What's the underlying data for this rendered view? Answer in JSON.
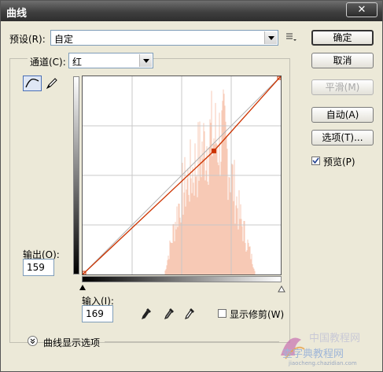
{
  "window": {
    "title": "曲线",
    "close_label": "✕"
  },
  "preset": {
    "label": "预设(R):",
    "value": "自定"
  },
  "channel": {
    "label": "通道(C):",
    "value": "红"
  },
  "buttons": {
    "ok": "确定",
    "cancel": "取消",
    "smooth": "平滑(M)",
    "auto": "自动(A)",
    "options": "选项(T)..."
  },
  "preview": {
    "label": "预览(P)",
    "checked": true
  },
  "output": {
    "label": "输出(O):",
    "value": "159"
  },
  "input": {
    "label": "输入(I):",
    "value": "169"
  },
  "clipping": {
    "label": "显示修剪(W)",
    "checked": false
  },
  "curve_options": {
    "label": "曲线显示选项"
  },
  "watermark": {
    "line1": "中国教程网",
    "line2": "查字典教程网",
    "line3": "jiaocheng.chazidian.com"
  },
  "curve": {
    "control_point": {
      "input": 169,
      "output": 159
    },
    "color": "#cc3300"
  },
  "histogram_color": "#f7c9b5"
}
